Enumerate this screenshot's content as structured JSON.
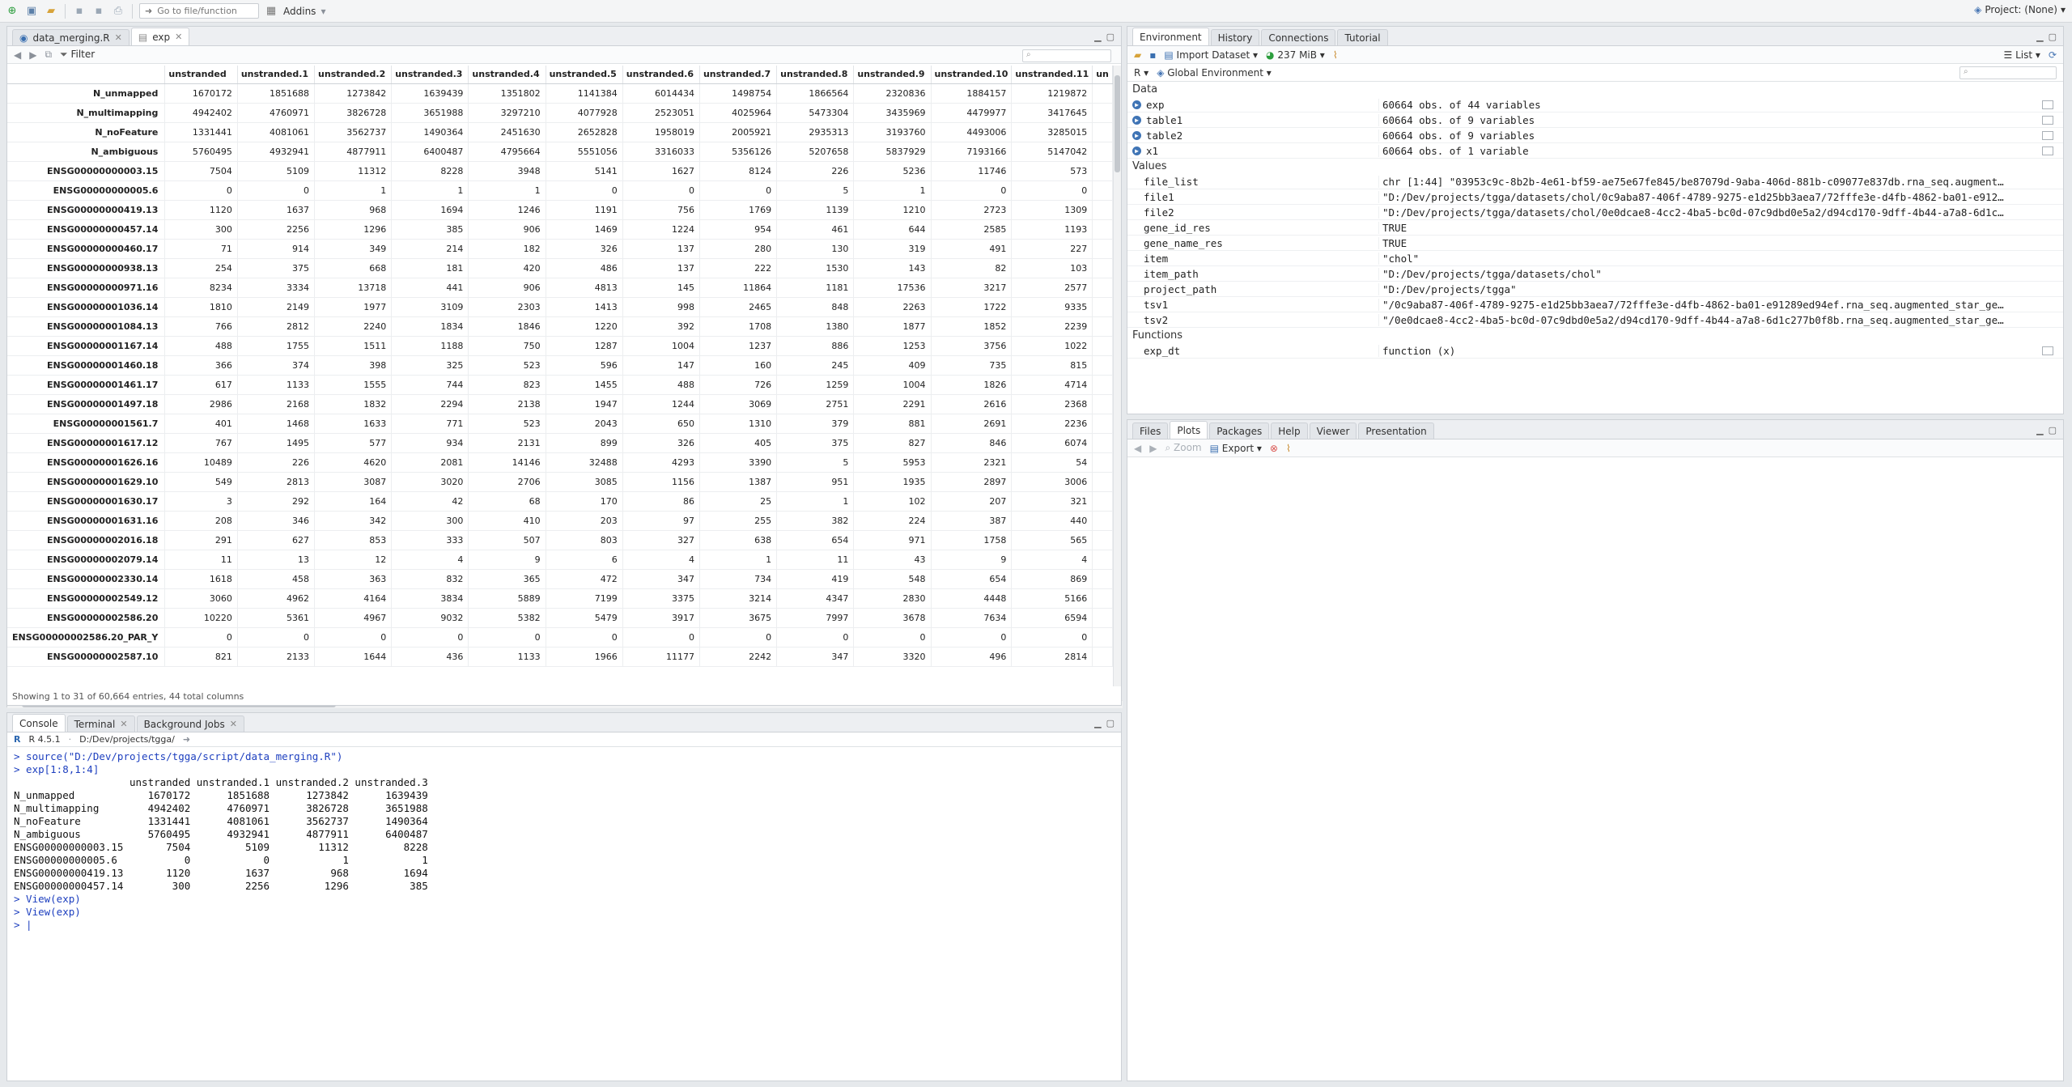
{
  "toolbar": {
    "goto_placeholder": "Go to file/function",
    "addins_label": "Addins",
    "project_label": "Project: (None)"
  },
  "source": {
    "tabs": [
      "data_merging.R",
      "exp"
    ],
    "filter_label": "Filter",
    "status": "Showing 1 to 31 of 60,664 entries, 44 total columns",
    "columns": [
      "",
      "unstranded",
      "unstranded.1",
      "unstranded.2",
      "unstranded.3",
      "unstranded.4",
      "unstranded.5",
      "unstranded.6",
      "unstranded.7",
      "unstranded.8",
      "unstranded.9",
      "unstranded.10",
      "unstranded.11",
      "un"
    ],
    "rows": [
      [
        "N_unmapped",
        "1670172",
        "1851688",
        "1273842",
        "1639439",
        "1351802",
        "1141384",
        "6014434",
        "1498754",
        "1866564",
        "2320836",
        "1884157",
        "1219872"
      ],
      [
        "N_multimapping",
        "4942402",
        "4760971",
        "3826728",
        "3651988",
        "3297210",
        "4077928",
        "2523051",
        "4025964",
        "5473304",
        "3435969",
        "4479977",
        "3417645"
      ],
      [
        "N_noFeature",
        "1331441",
        "4081061",
        "3562737",
        "1490364",
        "2451630",
        "2652828",
        "1958019",
        "2005921",
        "2935313",
        "3193760",
        "4493006",
        "3285015"
      ],
      [
        "N_ambiguous",
        "5760495",
        "4932941",
        "4877911",
        "6400487",
        "4795664",
        "5551056",
        "3316033",
        "5356126",
        "5207658",
        "5837929",
        "7193166",
        "5147042"
      ],
      [
        "ENSG00000000003.15",
        "7504",
        "5109",
        "11312",
        "8228",
        "3948",
        "5141",
        "1627",
        "8124",
        "226",
        "5236",
        "11746",
        "573"
      ],
      [
        "ENSG00000000005.6",
        "0",
        "0",
        "1",
        "1",
        "1",
        "0",
        "0",
        "0",
        "5",
        "1",
        "0",
        "0"
      ],
      [
        "ENSG00000000419.13",
        "1120",
        "1637",
        "968",
        "1694",
        "1246",
        "1191",
        "756",
        "1769",
        "1139",
        "1210",
        "2723",
        "1309"
      ],
      [
        "ENSG00000000457.14",
        "300",
        "2256",
        "1296",
        "385",
        "906",
        "1469",
        "1224",
        "954",
        "461",
        "644",
        "2585",
        "1193"
      ],
      [
        "ENSG00000000460.17",
        "71",
        "914",
        "349",
        "214",
        "182",
        "326",
        "137",
        "280",
        "130",
        "319",
        "491",
        "227"
      ],
      [
        "ENSG00000000938.13",
        "254",
        "375",
        "668",
        "181",
        "420",
        "486",
        "137",
        "222",
        "1530",
        "143",
        "82",
        "103"
      ],
      [
        "ENSG00000000971.16",
        "8234",
        "3334",
        "13718",
        "441",
        "906",
        "4813",
        "145",
        "11864",
        "1181",
        "17536",
        "3217",
        "2577"
      ],
      [
        "ENSG00000001036.14",
        "1810",
        "2149",
        "1977",
        "3109",
        "2303",
        "1413",
        "998",
        "2465",
        "848",
        "2263",
        "1722",
        "9335"
      ],
      [
        "ENSG00000001084.13",
        "766",
        "2812",
        "2240",
        "1834",
        "1846",
        "1220",
        "392",
        "1708",
        "1380",
        "1877",
        "1852",
        "2239"
      ],
      [
        "ENSG00000001167.14",
        "488",
        "1755",
        "1511",
        "1188",
        "750",
        "1287",
        "1004",
        "1237",
        "886",
        "1253",
        "3756",
        "1022"
      ],
      [
        "ENSG00000001460.18",
        "366",
        "374",
        "398",
        "325",
        "523",
        "596",
        "147",
        "160",
        "245",
        "409",
        "735",
        "815"
      ],
      [
        "ENSG00000001461.17",
        "617",
        "1133",
        "1555",
        "744",
        "823",
        "1455",
        "488",
        "726",
        "1259",
        "1004",
        "1826",
        "4714"
      ],
      [
        "ENSG00000001497.18",
        "2986",
        "2168",
        "1832",
        "2294",
        "2138",
        "1947",
        "1244",
        "3069",
        "2751",
        "2291",
        "2616",
        "2368"
      ],
      [
        "ENSG00000001561.7",
        "401",
        "1468",
        "1633",
        "771",
        "523",
        "2043",
        "650",
        "1310",
        "379",
        "881",
        "2691",
        "2236"
      ],
      [
        "ENSG00000001617.12",
        "767",
        "1495",
        "577",
        "934",
        "2131",
        "899",
        "326",
        "405",
        "375",
        "827",
        "846",
        "6074"
      ],
      [
        "ENSG00000001626.16",
        "10489",
        "226",
        "4620",
        "2081",
        "14146",
        "32488",
        "4293",
        "3390",
        "5",
        "5953",
        "2321",
        "54"
      ],
      [
        "ENSG00000001629.10",
        "549",
        "2813",
        "3087",
        "3020",
        "2706",
        "3085",
        "1156",
        "1387",
        "951",
        "1935",
        "2897",
        "3006"
      ],
      [
        "ENSG00000001630.17",
        "3",
        "292",
        "164",
        "42",
        "68",
        "170",
        "86",
        "25",
        "1",
        "102",
        "207",
        "321"
      ],
      [
        "ENSG00000001631.16",
        "208",
        "346",
        "342",
        "300",
        "410",
        "203",
        "97",
        "255",
        "382",
        "224",
        "387",
        "440"
      ],
      [
        "ENSG00000002016.18",
        "291",
        "627",
        "853",
        "333",
        "507",
        "803",
        "327",
        "638",
        "654",
        "971",
        "1758",
        "565"
      ],
      [
        "ENSG00000002079.14",
        "11",
        "13",
        "12",
        "4",
        "9",
        "6",
        "4",
        "1",
        "11",
        "43",
        "9",
        "4"
      ],
      [
        "ENSG00000002330.14",
        "1618",
        "458",
        "363",
        "832",
        "365",
        "472",
        "347",
        "734",
        "419",
        "548",
        "654",
        "869"
      ],
      [
        "ENSG00000002549.12",
        "3060",
        "4962",
        "4164",
        "3834",
        "5889",
        "7199",
        "3375",
        "3214",
        "4347",
        "2830",
        "4448",
        "5166"
      ],
      [
        "ENSG00000002586.20",
        "10220",
        "5361",
        "4967",
        "9032",
        "5382",
        "5479",
        "3917",
        "3675",
        "7997",
        "3678",
        "7634",
        "6594"
      ],
      [
        "ENSG00000002586.20_PAR_Y",
        "0",
        "0",
        "0",
        "0",
        "0",
        "0",
        "0",
        "0",
        "0",
        "0",
        "0",
        "0"
      ],
      [
        "ENSG00000002587.10",
        "821",
        "2133",
        "1644",
        "436",
        "1133",
        "1966",
        "11177",
        "2242",
        "347",
        "3320",
        "496",
        "2814"
      ]
    ]
  },
  "console": {
    "tabs": [
      "Console",
      "Terminal",
      "Background Jobs"
    ],
    "version": "R 4.5.1",
    "path": "D:/Dev/projects/tgga/",
    "lines": [
      {
        "kind": "cmd",
        "text": "> source(\"D:/Dev/projects/tgga/script/data_merging.R\")"
      },
      {
        "kind": "cmd",
        "text": "> exp[1:8,1:4]"
      },
      {
        "kind": "out",
        "text": "                   unstranded unstranded.1 unstranded.2 unstranded.3"
      },
      {
        "kind": "out",
        "text": "N_unmapped            1670172      1851688      1273842      1639439"
      },
      {
        "kind": "out",
        "text": "N_multimapping        4942402      4760971      3826728      3651988"
      },
      {
        "kind": "out",
        "text": "N_noFeature           1331441      4081061      3562737      1490364"
      },
      {
        "kind": "out",
        "text": "N_ambiguous           5760495      4932941      4877911      6400487"
      },
      {
        "kind": "out",
        "text": "ENSG00000000003.15       7504         5109        11312         8228"
      },
      {
        "kind": "out",
        "text": "ENSG00000000005.6           0            0            1            1"
      },
      {
        "kind": "out",
        "text": "ENSG00000000419.13       1120         1637          968         1694"
      },
      {
        "kind": "out",
        "text": "ENSG00000000457.14        300         2256         1296          385"
      },
      {
        "kind": "cmd",
        "text": "> View(exp)"
      },
      {
        "kind": "cmd",
        "text": "> View(exp)"
      },
      {
        "kind": "cmd",
        "text": "> |"
      }
    ]
  },
  "env": {
    "tabs": [
      "Environment",
      "History",
      "Connections",
      "Tutorial"
    ],
    "import_label": "Import Dataset",
    "memory": "237 MiB",
    "view_mode": "List",
    "lang": "R",
    "scope": "Global Environment",
    "sections": {
      "data": "Data",
      "values": "Values",
      "functions": "Functions"
    },
    "data": [
      {
        "name": "exp",
        "value": "60664 obs. of 44 variables"
      },
      {
        "name": "table1",
        "value": "60664 obs. of 9 variables"
      },
      {
        "name": "table2",
        "value": "60664 obs. of 9 variables"
      },
      {
        "name": "x1",
        "value": "60664 obs. of 1 variable"
      }
    ],
    "values": [
      {
        "name": "file_list",
        "value": "chr [1:44] \"03953c9c-8b2b-4e61-bf59-ae75e67fe845/be87079d-9aba-406d-881b-c09077e837db.rna_seq.augment…"
      },
      {
        "name": "file1",
        "value": "\"D:/Dev/projects/tgga/datasets/chol/0c9aba87-406f-4789-9275-e1d25bb3aea7/72fffe3e-d4fb-4862-ba01-e912…"
      },
      {
        "name": "file2",
        "value": "\"D:/Dev/projects/tgga/datasets/chol/0e0dcae8-4cc2-4ba5-bc0d-07c9dbd0e5a2/d94cd170-9dff-4b44-a7a8-6d1c…"
      },
      {
        "name": "gene_id_res",
        "value": "TRUE"
      },
      {
        "name": "gene_name_res",
        "value": "TRUE"
      },
      {
        "name": "item",
        "value": "\"chol\""
      },
      {
        "name": "item_path",
        "value": "\"D:/Dev/projects/tgga/datasets/chol\""
      },
      {
        "name": "project_path",
        "value": "\"D:/Dev/projects/tgga\""
      },
      {
        "name": "tsv1",
        "value": "\"/0c9aba87-406f-4789-9275-e1d25bb3aea7/72fffe3e-d4fb-4862-ba01-e91289ed94ef.rna_seq.augmented_star_ge…"
      },
      {
        "name": "tsv2",
        "value": "\"/0e0dcae8-4cc2-4ba5-bc0d-07c9dbd0e5a2/d94cd170-9dff-4b44-a7a8-6d1c277b0f8b.rna_seq.augmented_star_ge…"
      }
    ],
    "functions": [
      {
        "name": "exp_dt",
        "value": "function (x)"
      }
    ]
  },
  "plots": {
    "tabs": [
      "Files",
      "Plots",
      "Packages",
      "Help",
      "Viewer",
      "Presentation"
    ],
    "zoom_label": "Zoom",
    "export_label": "Export"
  }
}
